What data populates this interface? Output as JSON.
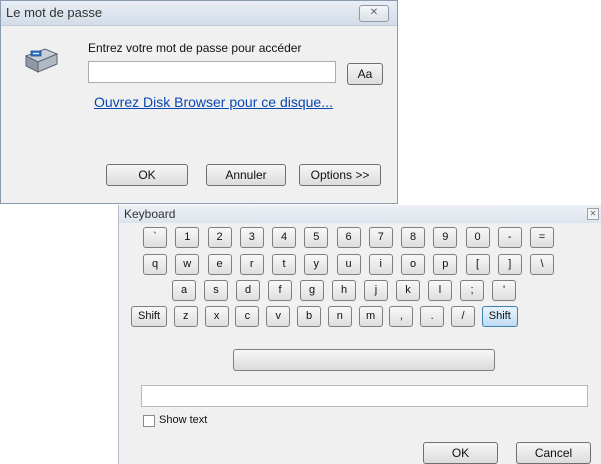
{
  "password_dialog": {
    "title": "Le mot de passe",
    "close_glyph": "✕",
    "prompt": "Entrez votre mot de passe pour accéder",
    "password_value": "",
    "aa_label": "Aa",
    "link_text": "Ouvrez Disk Browser pour ce disque...",
    "ok_label": "OK",
    "cancel_label": "Annuler",
    "options_label": "Options >>",
    "icon": "drive-icon"
  },
  "keyboard": {
    "title": "Keyboard",
    "close_glyph": "✕",
    "rows": [
      [
        "`",
        "1",
        "2",
        "3",
        "4",
        "5",
        "6",
        "7",
        "8",
        "9",
        "0",
        "-",
        "="
      ],
      [
        "q",
        "w",
        "e",
        "r",
        "t",
        "y",
        "u",
        "i",
        "o",
        "p",
        "[",
        "]",
        "\\"
      ],
      [
        "a",
        "s",
        "d",
        "f",
        "g",
        "h",
        "j",
        "k",
        "l",
        ";",
        "'"
      ],
      [
        "Shift",
        "z",
        "x",
        "c",
        "v",
        "b",
        "n",
        "m",
        ",",
        ".",
        "/",
        "Shift"
      ]
    ],
    "text_value": "",
    "show_text_label": "Show text",
    "show_text_checked": false,
    "ok_label": "OK",
    "cancel_label": "Cancel"
  },
  "colors": {
    "link": "#0a47b3",
    "active_key": "#bfdcf3",
    "window_bg": "#f0f0f0"
  }
}
